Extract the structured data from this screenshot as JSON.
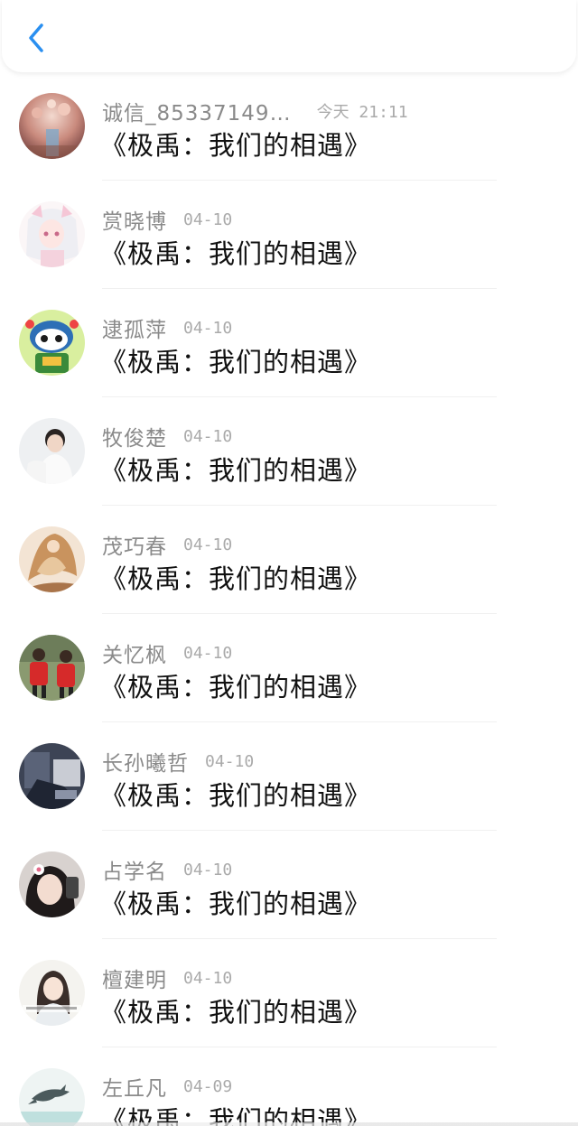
{
  "header": {
    "back_icon": "chevron-left-icon",
    "accent_color": "#2a8ff0"
  },
  "items": [
    {
      "name": "诚信_85337149…",
      "time": "今天 21:11",
      "message": "《极禹：我们的相遇》",
      "avatar": "floral-sunset"
    },
    {
      "name": "赏晓博",
      "time": "04-10",
      "message": "《极禹：我们的相遇》",
      "avatar": "anime-white-hair"
    },
    {
      "name": "逮孤萍",
      "time": "04-10",
      "message": "《极禹：我们的相遇》",
      "avatar": "cartoon-cat"
    },
    {
      "name": "牧俊楚",
      "time": "04-10",
      "message": "《极禹：我们的相遇》",
      "avatar": "boy-white-shirt"
    },
    {
      "name": "茂巧春",
      "time": "04-10",
      "message": "《极禹：我们的相遇》",
      "avatar": "golden-figure"
    },
    {
      "name": "关忆枫",
      "time": "04-10",
      "message": "《极禹：我们的相遇》",
      "avatar": "kids-red-jackets"
    },
    {
      "name": "长孙曦哲",
      "time": "04-10",
      "message": "《极禹：我们的相遇》",
      "avatar": "dark-photo"
    },
    {
      "name": "占学名",
      "time": "04-10",
      "message": "《极禹：我们的相遇》",
      "avatar": "girl-flower-hair"
    },
    {
      "name": "檀建明",
      "time": "04-10",
      "message": "《极禹：我们的相遇》",
      "avatar": "girl-with-text"
    },
    {
      "name": "左丘凡",
      "time": "04-09",
      "message": "《极禹：我们的相遇》",
      "avatar": "dolphin"
    }
  ]
}
